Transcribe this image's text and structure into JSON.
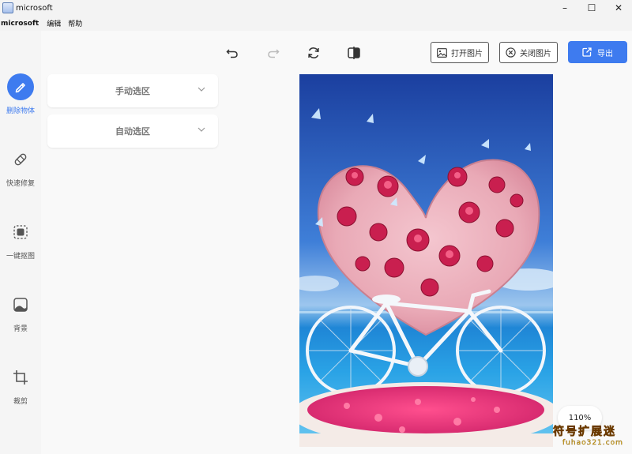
{
  "window": {
    "title": "microsoft",
    "controls": [
      "–",
      "☐",
      "✕"
    ]
  },
  "menu": {
    "brand": "microsoft",
    "items": [
      "编辑",
      "帮助"
    ]
  },
  "tools": [
    {
      "label": "删除物体",
      "icon": "eraser-icon",
      "active": true
    },
    {
      "label": "快速修复",
      "icon": "bandage-icon",
      "active": false
    },
    {
      "label": "一键抠图",
      "icon": "cutout-icon",
      "active": false
    },
    {
      "label": "背景",
      "icon": "background-image-icon",
      "active": false
    },
    {
      "label": "裁剪",
      "icon": "crop-icon",
      "active": false
    }
  ],
  "panels": [
    {
      "title": "手动选区",
      "expanded": false
    },
    {
      "title": "自动选区",
      "expanded": false
    }
  ],
  "toolbar": {
    "undo_icon": "undo-icon",
    "redo_icon": "redo-icon",
    "reset_icon": "refresh-icon",
    "compare_icon": "compare-icon",
    "open_label": "打开图片",
    "close_label": "关闭图片",
    "export_label": "导出"
  },
  "zoom": "110%",
  "watermark": {
    "line1": "符号扩展迷",
    "line2": "fuhao321.com"
  },
  "colors": {
    "accent": "#3e7bef"
  }
}
